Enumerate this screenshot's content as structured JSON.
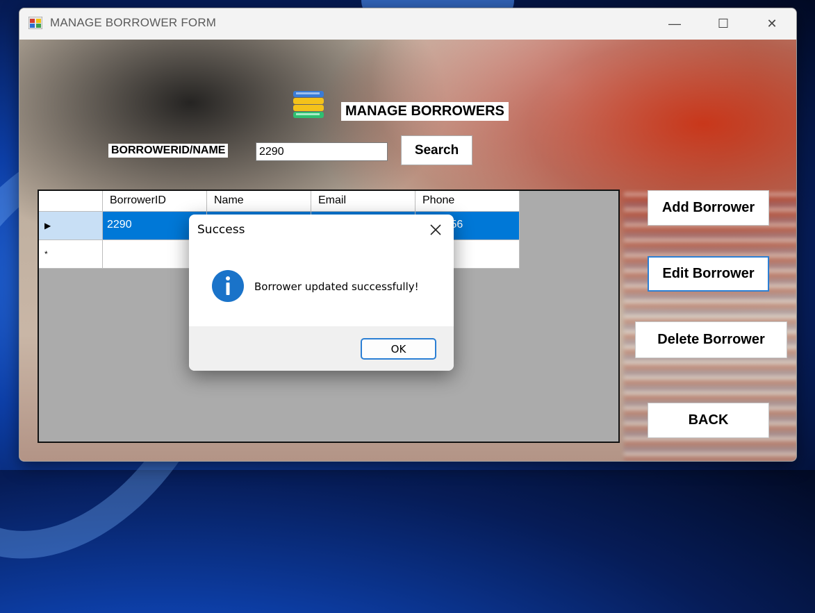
{
  "window": {
    "title": "MANAGE BORROWER FORM",
    "controls": {
      "minimize": "—",
      "maximize": "☐",
      "close": "✕"
    }
  },
  "header": {
    "title": "MANAGE BORROWERS",
    "icon": "books-icon"
  },
  "search": {
    "label": "BORROWERID/NAME",
    "value": "2290",
    "button": "Search"
  },
  "grid": {
    "columns": [
      "BorrowerID",
      "Name",
      "Email",
      "Phone"
    ],
    "rows": [
      {
        "indicator": "▶",
        "cells": [
          "2290",
          "",
          "",
          "2344356"
        ]
      }
    ],
    "new_row_indicator": "*"
  },
  "actions": {
    "add": "Add Borrower",
    "edit": "Edit Borrower",
    "delete": "Delete Borrower",
    "back": "BACK"
  },
  "dialog": {
    "title": "Success",
    "message": "Borrower updated successfully!",
    "ok": "OK",
    "icon": "info-icon"
  },
  "colors": {
    "selection": "#0078d7",
    "accent": "#2b7fd4",
    "info_icon": "#1a73c9"
  }
}
